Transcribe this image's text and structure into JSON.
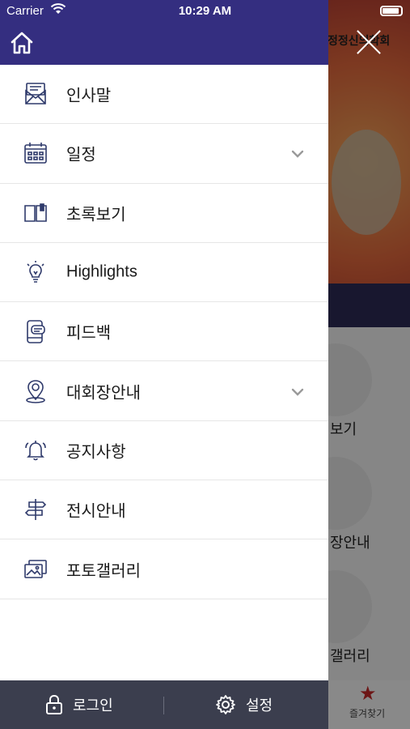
{
  "status_bar": {
    "carrier": "Carrier",
    "time": "10:29 AM"
  },
  "background": {
    "logo_text": "정정신의학회",
    "labels": [
      "보기",
      "장안내",
      "갤러리"
    ],
    "favorites_label": "즐겨찾기"
  },
  "drawer": {
    "menu": [
      {
        "label": "인사말",
        "icon": "greeting-letter-icon",
        "expandable": false
      },
      {
        "label": "일정",
        "icon": "calendar-icon",
        "expandable": true
      },
      {
        "label": "초록보기",
        "icon": "abstract-book-icon",
        "expandable": false
      },
      {
        "label": "Highlights",
        "icon": "lightbulb-icon",
        "expandable": false
      },
      {
        "label": "피드백",
        "icon": "feedback-phone-icon",
        "expandable": false
      },
      {
        "label": "대회장안내",
        "icon": "venue-location-icon",
        "expandable": true
      },
      {
        "label": "공지사항",
        "icon": "notice-bell-icon",
        "expandable": false
      },
      {
        "label": "전시안내",
        "icon": "exhibition-signpost-icon",
        "expandable": false
      },
      {
        "label": "포토갤러리",
        "icon": "photo-gallery-icon",
        "expandable": false
      }
    ],
    "footer": {
      "login_label": "로그인",
      "settings_label": "설정"
    }
  },
  "colors": {
    "drawer_header": "#342e80",
    "footer": "#3b3e4e",
    "icon_stroke": "#2f3a6b"
  }
}
